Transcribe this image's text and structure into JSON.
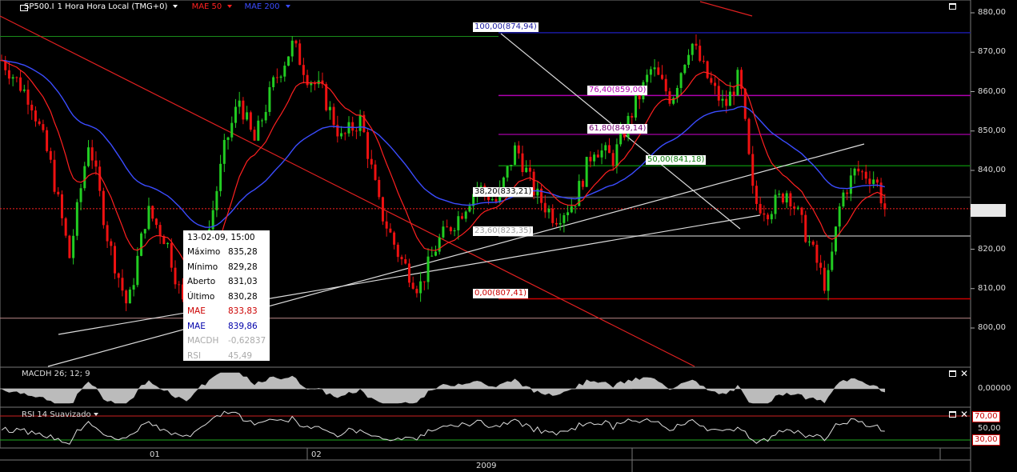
{
  "header": {
    "symbol": "SP500.I",
    "interval": "1 Hora Hora Local (TMG+0)",
    "ma1_label": "MAE 50",
    "ma2_label": "MAE 200",
    "ma1_color": "#ff2020",
    "ma2_color": "#3b4cff"
  },
  "panels": {
    "macd_label": "MACDH 26; 12; 9",
    "rsi_label": "RSI 14 Suavizado",
    "macd_axis": "0,00000",
    "rsi_axis": "50,00",
    "rsi_upper": "70,00",
    "rsi_lower": "30,00"
  },
  "tooltip": {
    "date": "13-02-09, 15:00",
    "rows": [
      {
        "label": "Máximo",
        "value": "835,28",
        "color": "#000000"
      },
      {
        "label": "Mínimo",
        "value": "829,28",
        "color": "#000000"
      },
      {
        "label": "Aberto",
        "value": "831,03",
        "color": "#000000"
      },
      {
        "label": "Último",
        "value": "830,28",
        "color": "#000000"
      },
      {
        "label": "MAE",
        "value": "833,83",
        "color": "#cc0000"
      },
      {
        "label": "MAE",
        "value": "839,86",
        "color": "#0000aa"
      },
      {
        "label": "MACDH",
        "value": "-0,62837",
        "color": "#aaaaaa"
      },
      {
        "label": "RSI",
        "value": "45,49",
        "color": "#aaaaaa"
      }
    ]
  },
  "fib_labels": [
    {
      "text": "100,00(874,94)",
      "color": "#1a1aa0"
    },
    {
      "text": "76,40(859,00)",
      "color": "#b000b0"
    },
    {
      "text": "61,80(849,14)",
      "color": "#700070"
    },
    {
      "text": "50,00(841,18)",
      "color": "#0a7a0a"
    },
    {
      "text": "38,20(833,21)",
      "color": "#000000"
    },
    {
      "text": "23,60(823,35)",
      "color": "#999999"
    },
    {
      "text": "0,00(807,41)",
      "color": "#cc0000"
    }
  ],
  "x_labels": [
    "01",
    "02"
  ],
  "year_label": "2009",
  "chart_data": {
    "type": "candlestick",
    "y_ticks": [
      "800,00",
      "810,00",
      "820,00",
      "830,00",
      "840,00",
      "850,00",
      "860,00",
      "870,00",
      "880,00"
    ],
    "ylim": [
      795,
      884
    ],
    "last_price": 830.28,
    "fibonacci_levels": [
      874.94,
      859.0,
      849.14,
      841.18,
      833.21,
      823.35,
      807.41
    ],
    "series": [
      {
        "name": "MAE 50",
        "color": "#ff2020"
      },
      {
        "name": "MAE 200",
        "color": "#3b4cff"
      }
    ],
    "price_path": [
      [
        0,
        868
      ],
      [
        0.03,
        858
      ],
      [
        0.05,
        842
      ],
      [
        0.07,
        818
      ],
      [
        0.09,
        848
      ],
      [
        0.11,
        822
      ],
      [
        0.13,
        805
      ],
      [
        0.15,
        830
      ],
      [
        0.17,
        822
      ],
      [
        0.19,
        803
      ],
      [
        0.21,
        820
      ],
      [
        0.23,
        846
      ],
      [
        0.245,
        858
      ],
      [
        0.26,
        847
      ],
      [
        0.28,
        862
      ],
      [
        0.3,
        872
      ],
      [
        0.315,
        864
      ],
      [
        0.33,
        860
      ],
      [
        0.35,
        848
      ],
      [
        0.37,
        853
      ],
      [
        0.39,
        830
      ],
      [
        0.41,
        818
      ],
      [
        0.43,
        810
      ],
      [
        0.45,
        822
      ],
      [
        0.47,
        828
      ],
      [
        0.49,
        836
      ],
      [
        0.51,
        832
      ],
      [
        0.53,
        846
      ],
      [
        0.55,
        834
      ],
      [
        0.57,
        828
      ],
      [
        0.59,
        832
      ],
      [
        0.61,
        846
      ],
      [
        0.63,
        843
      ],
      [
        0.65,
        855
      ],
      [
        0.67,
        866
      ],
      [
        0.69,
        858
      ],
      [
        0.71,
        873
      ],
      [
        0.73,
        862
      ],
      [
        0.745,
        856
      ],
      [
        0.76,
        864
      ],
      [
        0.775,
        832
      ],
      [
        0.79,
        830
      ],
      [
        0.81,
        835
      ],
      [
        0.83,
        823
      ],
      [
        0.85,
        810
      ],
      [
        0.865,
        833
      ],
      [
        0.88,
        840
      ],
      [
        0.9,
        838
      ],
      [
        0.91,
        830.28
      ]
    ]
  }
}
